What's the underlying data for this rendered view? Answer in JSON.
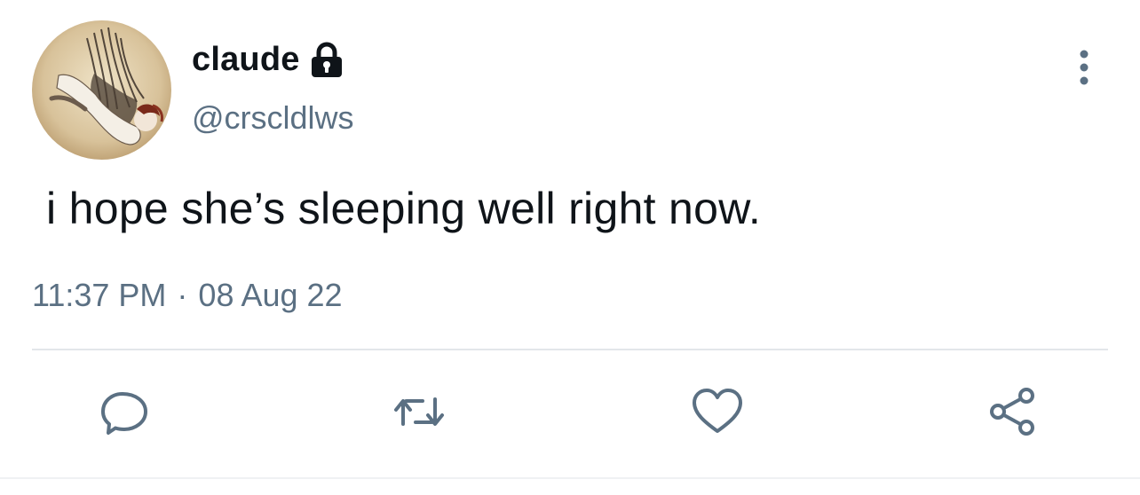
{
  "user": {
    "display_name": "claude",
    "handle": "@crscldlws",
    "protected_icon": "lock-icon"
  },
  "tweet": {
    "text": "i hope she’s sleeping well right now.",
    "time": "11:37 PM",
    "separator": "·",
    "date": "08 Aug 22"
  },
  "actions": {
    "reply_icon": "speech-bubble-icon",
    "retweet_icon": "retweet-arrows-icon",
    "like_icon": "heart-icon",
    "share_icon": "share-nodes-icon",
    "more_icon": "vertical-ellipsis-icon"
  },
  "colors": {
    "text_primary": "#0f1419",
    "text_secondary": "#5b7083",
    "icon": "#5b7083",
    "divider": "#e3e6ea"
  }
}
